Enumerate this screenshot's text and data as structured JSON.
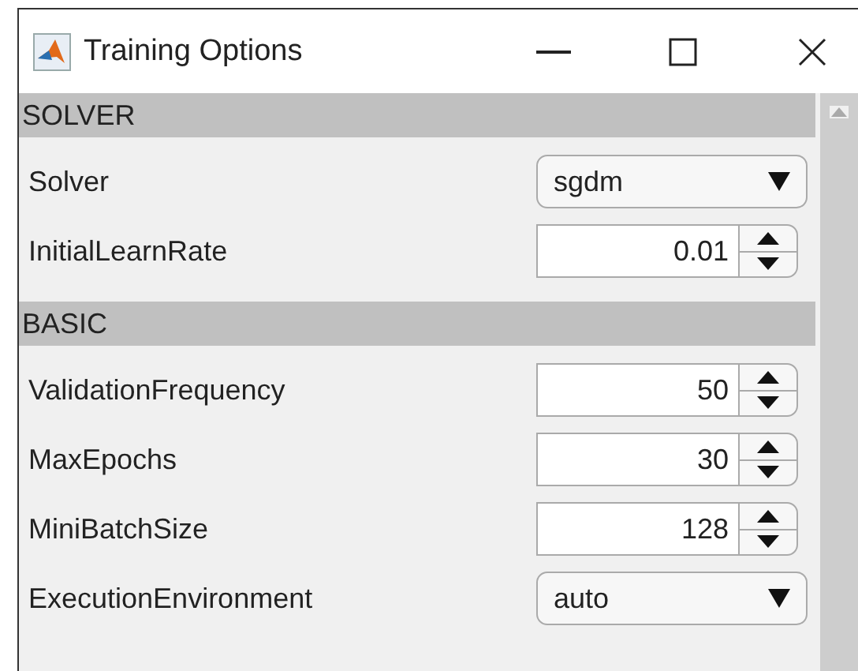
{
  "window": {
    "title": "Training Options"
  },
  "sections": [
    {
      "title": "SOLVER",
      "rows": [
        {
          "label": "Solver",
          "kind": "dropdown",
          "value": "sgdm"
        },
        {
          "label": "InitialLearnRate",
          "kind": "spinner",
          "value": "0.01"
        }
      ]
    },
    {
      "title": "BASIC",
      "rows": [
        {
          "label": "ValidationFrequency",
          "kind": "spinner",
          "value": "50"
        },
        {
          "label": "MaxEpochs",
          "kind": "spinner",
          "value": "30"
        },
        {
          "label": "MiniBatchSize",
          "kind": "spinner",
          "value": "128"
        },
        {
          "label": "ExecutionEnvironment",
          "kind": "dropdown",
          "value": "auto"
        }
      ]
    }
  ]
}
